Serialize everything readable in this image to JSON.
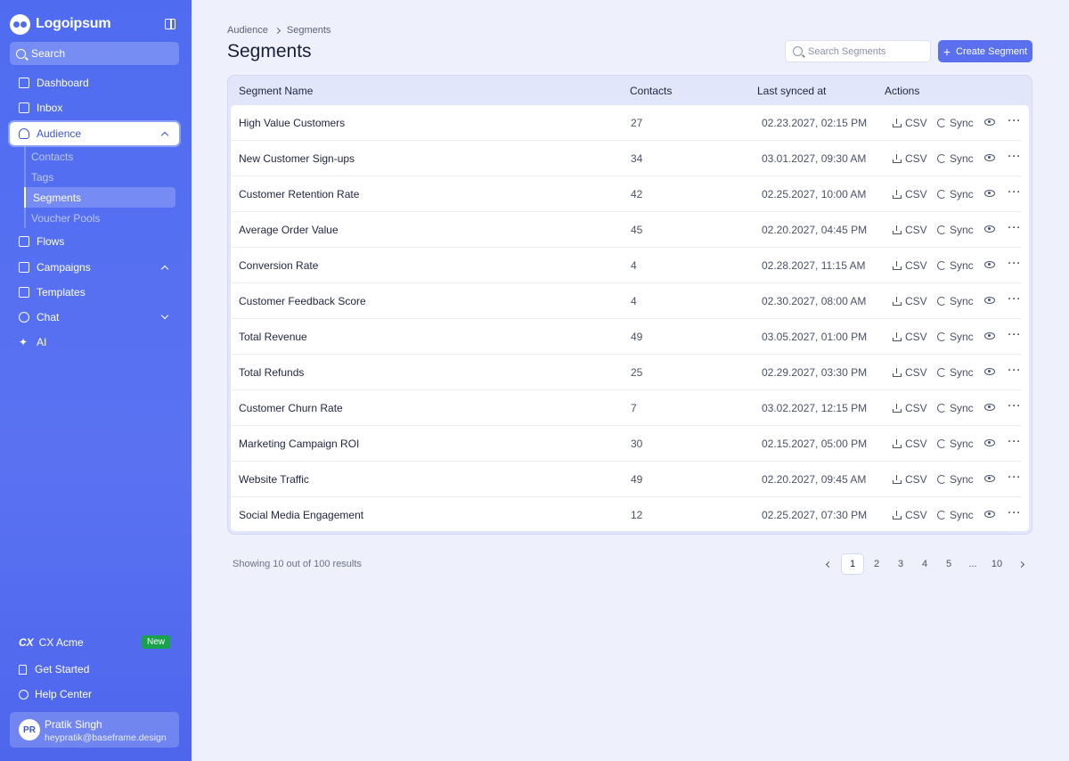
{
  "sidebar": {
    "brand": "Logoipsum",
    "search_label": "Search",
    "nav": [
      {
        "label": "Dashboard"
      },
      {
        "label": "Inbox"
      },
      {
        "label": "Audience"
      },
      {
        "label": "Flows"
      },
      {
        "label": "Campaigns"
      },
      {
        "label": "Templates"
      },
      {
        "label": "Chat"
      },
      {
        "label": "AI"
      }
    ],
    "audience_sub": [
      {
        "label": "Contacts"
      },
      {
        "label": "Tags"
      },
      {
        "label": "Segments"
      },
      {
        "label": "Voucher Pools"
      }
    ],
    "workspace": {
      "mark": "CX",
      "name": "CX Acme",
      "badge": "New"
    },
    "get_started": "Get Started",
    "help_center": "Help Center",
    "user": {
      "initials": "PR",
      "name": "Pratik Singh",
      "email": "heypratik@baseframe.design"
    }
  },
  "header": {
    "breadcrumb": [
      "Audience",
      "Segments"
    ],
    "title": "Segments",
    "search_placeholder": "Search Segments",
    "create_label": "Create Segment"
  },
  "table": {
    "columns": [
      "Segment Name",
      "Contacts",
      "Last synced at",
      "Actions"
    ],
    "csv_label": "CSV",
    "sync_label": "Sync",
    "rows": [
      {
        "name": "High Value Customers",
        "contacts": "27",
        "synced": "02.23.2027, 02:15 PM"
      },
      {
        "name": "New Customer Sign-ups",
        "contacts": "34",
        "synced": "03.01.2027, 09:30 AM"
      },
      {
        "name": "Customer Retention Rate",
        "contacts": "42",
        "synced": "02.25.2027, 10:00 AM"
      },
      {
        "name": "Average Order Value",
        "contacts": "45",
        "synced": "02.20.2027, 04:45 PM"
      },
      {
        "name": "Conversion Rate",
        "contacts": "4",
        "synced": "02.28.2027, 11:15 AM"
      },
      {
        "name": "Customer Feedback Score",
        "contacts": "4",
        "synced": "02.30.2027, 08:00 AM"
      },
      {
        "name": "Total Revenue",
        "contacts": "49",
        "synced": "03.05.2027, 01:00 PM"
      },
      {
        "name": "Total Refunds",
        "contacts": "25",
        "synced": "02.29.2027, 03:30 PM"
      },
      {
        "name": "Customer Churn Rate",
        "contacts": "7",
        "synced": "03.02.2027, 12:15 PM"
      },
      {
        "name": "Marketing Campaign ROI",
        "contacts": "30",
        "synced": "02.15.2027, 05:00 PM"
      },
      {
        "name": "Website Traffic",
        "contacts": "49",
        "synced": "02.20.2027, 09:45 AM"
      },
      {
        "name": "Social Media Engagement",
        "contacts": "12",
        "synced": "02.25.2027, 07:30 PM"
      }
    ]
  },
  "footer": {
    "results": "Showing 10 out of 100 results",
    "pages": [
      "1",
      "2",
      "3",
      "4",
      "5",
      "...",
      "10"
    ]
  },
  "colors": {
    "sidebar": "#4f6cf0",
    "accent": "#5a70ee",
    "background": "#eef1fc"
  }
}
